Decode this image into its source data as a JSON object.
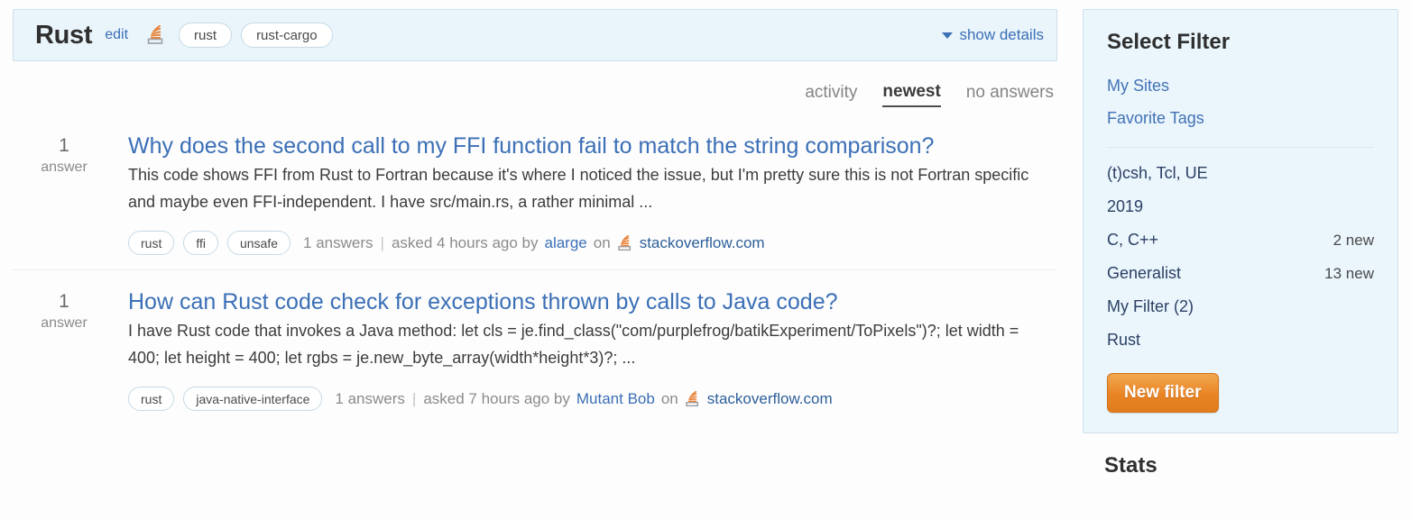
{
  "header": {
    "title": "Rust",
    "edit_label": "edit",
    "site_icon": "stackoverflow-icon",
    "tags": [
      "rust",
      "rust-cargo"
    ],
    "show_details_label": "show details",
    "caret_icon": "chevron-down-icon"
  },
  "tabs": [
    {
      "label": "activity",
      "active": false
    },
    {
      "label": "newest",
      "active": true
    },
    {
      "label": "no answers",
      "active": false
    }
  ],
  "questions": [
    {
      "count": "1",
      "count_label": "answer",
      "title": "Why does the second call to my FFI function fail to match the string comparison?",
      "excerpt": "This code shows FFI from Rust to Fortran because it's where I noticed the issue, but I'm pretty sure this is not Fortran specific and maybe even FFI-independent. I have src/main.rs, a rather minimal ...",
      "tags": [
        "rust",
        "ffi",
        "unsafe"
      ],
      "answers_text": "1 answers",
      "separator": "|",
      "asked_text": "asked 4 hours ago by",
      "author": "alarge",
      "on_text": "on",
      "site": "stackoverflow.com"
    },
    {
      "count": "1",
      "count_label": "answer",
      "title": "How can Rust code check for exceptions thrown by calls to Java code?",
      "excerpt": "I have Rust code that invokes a Java method: let cls = je.find_class(\"com/purplefrog/batikExperiment/ToPixels\")?; let width = 400; let height = 400; let rgbs = je.new_byte_array(width*height*3)?; ...",
      "tags": [
        "rust",
        "java-native-interface"
      ],
      "answers_text": "1 answers",
      "separator": "|",
      "asked_text": "asked 7 hours ago by",
      "author": "Mutant Bob",
      "on_text": "on",
      "site": "stackoverflow.com"
    }
  ],
  "sidebar": {
    "filter_panel_title": "Select Filter",
    "links": [
      {
        "label": "My Sites"
      },
      {
        "label": "Favorite Tags"
      }
    ],
    "filters": [
      {
        "name": "(t)csh, Tcl, UE",
        "count": ""
      },
      {
        "name": "2019",
        "count": ""
      },
      {
        "name": "C, C++",
        "count": "2 new"
      },
      {
        "name": "Generalist",
        "count": "13 new"
      },
      {
        "name": "My Filter (2)",
        "count": ""
      },
      {
        "name": "Rust",
        "count": ""
      }
    ],
    "new_filter_label": "New filter",
    "stats_title": "Stats"
  },
  "colors": {
    "panel_bg": "#eaf4fb",
    "panel_border": "#cfe0ea",
    "link": "#3b6fb6",
    "accent_orange": "#e98425",
    "text": "#3c3c3c",
    "muted": "#8b8b8b"
  }
}
